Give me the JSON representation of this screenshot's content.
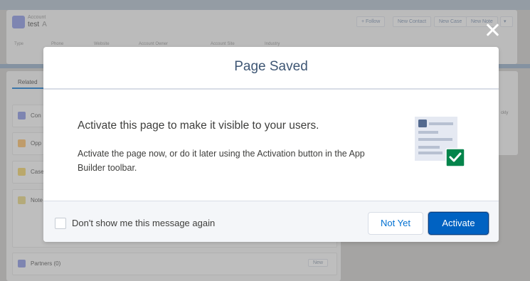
{
  "background": {
    "record": {
      "type_label": "Account",
      "name": "test",
      "name_suffix": "A",
      "actions": [
        "+ Follow",
        "New Contact",
        "New Case",
        "New Note"
      ],
      "fields": [
        "Type",
        "Phone",
        "Website",
        "Account Owner",
        "Account Site",
        "Industry"
      ]
    },
    "tabs": {
      "related": "Related"
    },
    "cards": [
      {
        "label": "Con",
        "color": "#7f8de1"
      },
      {
        "label": "Opp",
        "color": "#fcb95b"
      },
      {
        "label": "Case",
        "color": "#f2cf5b"
      },
      {
        "label": "Note",
        "color": "#e6d478"
      },
      {
        "label": "Partners (0)",
        "color": "#7f8de1"
      }
    ],
    "new_label": "New",
    "right_snippet": "ckly"
  },
  "modal": {
    "title": "Page Saved",
    "heading": "Activate this page to make it visible to your users.",
    "body": "Activate the page now, or do it later using the Activation button in the App Builder toolbar.",
    "checkbox_label": "Don't show me this message again",
    "checkbox_checked": false,
    "buttons": {
      "not_yet": "Not Yet",
      "activate": "Activate"
    }
  },
  "colors": {
    "brand": "#0070d2",
    "success": "#04844b",
    "title": "#3e5674"
  },
  "icons": {
    "close": "close-icon",
    "illustration": "page-checkmark-illustration"
  }
}
